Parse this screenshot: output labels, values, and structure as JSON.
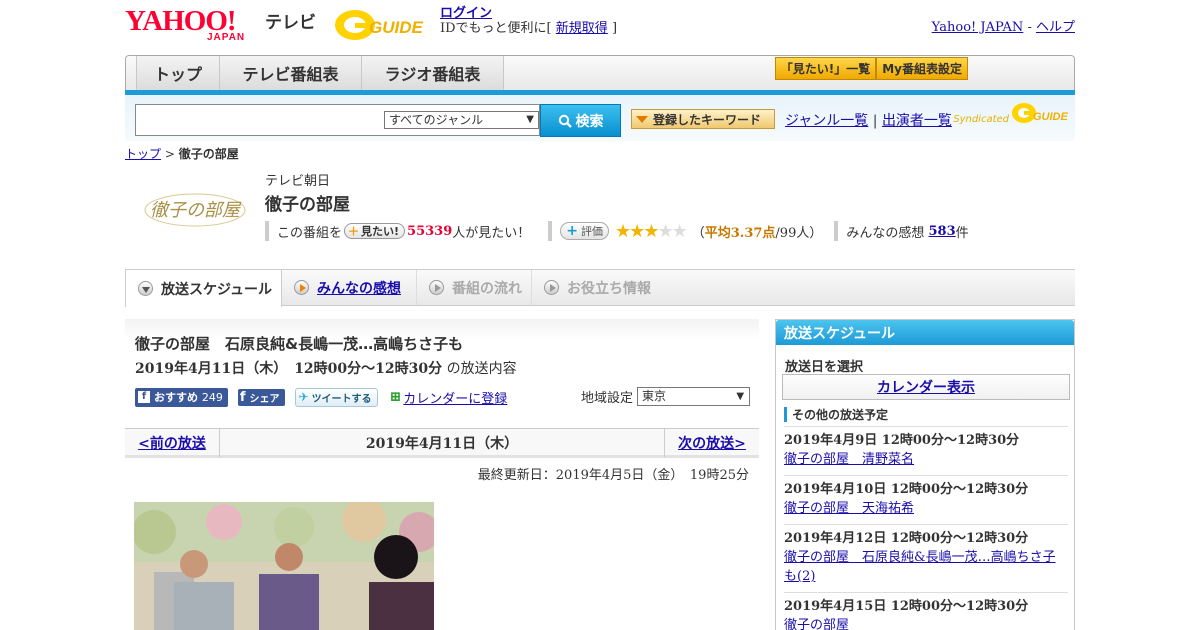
{
  "header": {
    "yahoo_logo": "YAHOO!",
    "yahoo_japan": "JAPAN",
    "tv": "テレビ",
    "gguide": "GUIDE",
    "login": "ログイン",
    "login_msg": "IDでもっと便利に[",
    "signup": "新規取得",
    "login_close": "]",
    "yahoo_japan_link": "Yahoo! JAPAN",
    "sep": "-",
    "help": "ヘルプ"
  },
  "nav": {
    "tabs": [
      "トップ",
      "テレビ番組表",
      "ラジオ番組表"
    ],
    "mitai_list": "「見たい!」一覧",
    "my_settings": "My番組表設定"
  },
  "search": {
    "placeholder": "",
    "genre": "すべてのジャンル",
    "button": "検索",
    "keyword_btn": "登録したキーワード",
    "genre_list": "ジャンル一覧",
    "divider": "|",
    "performers": "出演者一覧",
    "syndicated": "Syndicated"
  },
  "breadcrumb": {
    "top": "トップ",
    "sep": ">",
    "current": "徹子の部屋"
  },
  "program": {
    "logo_text": "徹子の部屋",
    "channel": "テレビ朝日",
    "title": "徹子の部屋",
    "mitai_prefix": "この番組を",
    "mitai_btn": "見たい!",
    "mitai_count": "55339",
    "mitai_suffix": "人が見たい！",
    "hyoka_btn": "評価",
    "rating_stars": 3,
    "rating_max": 5,
    "avg_open": "（",
    "avg": "平均3.37点",
    "avg_people": "/99人）",
    "kanso_label": "みんなの感想",
    "kanso_count": "583",
    "kanso_unit": "件"
  },
  "tabs": {
    "schedule": "放送スケジュール",
    "kanso": "みんなの感想",
    "flow": "番組の流れ",
    "info": "お役立ち情報"
  },
  "episode": {
    "title": "徹子の部屋　石原良純&長嶋一茂…高嶋ちさ子も",
    "datetime": "2019年4月11日（木）　12時00分～12時30分",
    "datetime_suffix": "の放送内容",
    "fb_rec": "おすすめ",
    "fb_count": "249",
    "fb_share": "シェア",
    "tweet": "ツイートする",
    "calendar": "カレンダーに登録",
    "region_label": "地域設定",
    "region": "東京",
    "prev": "<前の放送",
    "current_date": "2019年4月11日（木）",
    "next": "次の放送>",
    "updated": "最終更新日：2019年4月5日（金）　19時25分"
  },
  "sidebar": {
    "title": "放送スケジュール",
    "date_label": "放送日を選択",
    "calendar": "カレンダー表示",
    "other": "その他の放送予定",
    "items": [
      {
        "dt": "2019年4月9日  12時00分～12時30分",
        "title": "徹子の部屋　清野菜名"
      },
      {
        "dt": "2019年4月10日  12時00分～12時30分",
        "title": "徹子の部屋　天海祐希"
      },
      {
        "dt": "2019年4月12日  12時00分～12時30分",
        "title": "徹子の部屋　石原良純&長嶋一茂…高嶋ちさ子も(2)"
      },
      {
        "dt": "2019年4月15日  12時00分～12時30分",
        "title": "徹子の部屋"
      }
    ]
  }
}
